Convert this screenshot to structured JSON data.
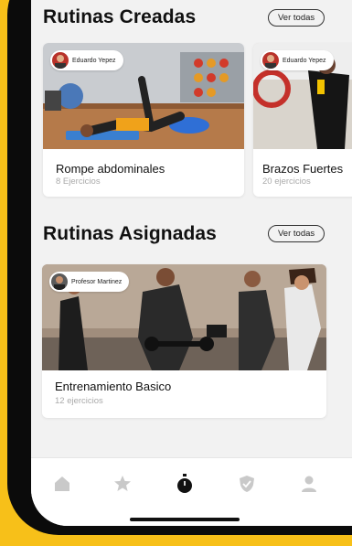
{
  "created": {
    "title": "Rutinas Creadas",
    "see_all": "Ver todas",
    "cards": [
      {
        "author": "Eduardo Yepez",
        "title": "Rompe abdominales",
        "subtitle": "8 Ejercicios"
      },
      {
        "author": "Eduardo Yepez",
        "title": "Brazos Fuertes",
        "subtitle": "20 ejercicios"
      }
    ]
  },
  "assigned": {
    "title": "Rutinas Asignadas",
    "see_all": "Ver todas",
    "cards": [
      {
        "author": "Profesor Martinez",
        "title": "Entrenamiento Basico",
        "subtitle": "12 ejercicios"
      }
    ]
  },
  "tabbar": {
    "items": [
      {
        "icon": "home-icon",
        "active": false
      },
      {
        "icon": "star-icon",
        "active": false
      },
      {
        "icon": "stopwatch-icon",
        "active": true
      },
      {
        "icon": "shield-icon",
        "active": false
      },
      {
        "icon": "user-icon",
        "active": false
      }
    ]
  },
  "colors": {
    "background": "#f7c019",
    "screen": "#f2f2f2",
    "active_icon": "#111111",
    "inactive_icon": "#c9c9c9"
  }
}
